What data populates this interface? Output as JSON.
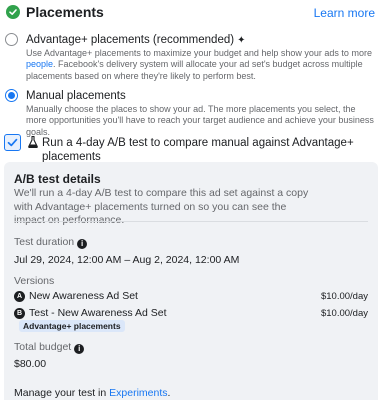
{
  "header": {
    "title": "Placements",
    "learn_more": "Learn more"
  },
  "advantage_option": {
    "title": "Advantage+ placements (recommended)",
    "description_before_link": "Use Advantage+ placements to maximize your budget and help show your ads to more ",
    "description_link": "people",
    "description_after_link": ". Facebook's delivery system will allocate your ad set's budget across multiple placements based on where they're likely to perform best.",
    "selected": false
  },
  "manual_option": {
    "title": "Manual placements",
    "description": "Manually choose the places to show your ad. The more placements you select, the more opportunities you'll have to reach your target audience and achieve your business goals.",
    "selected": true
  },
  "ab_test": {
    "label": "Run a 4-day A/B test to compare manual against Advantage+ placements",
    "checked": true
  },
  "details": {
    "title": "A/B test details",
    "description": "We'll run a 4-day A/B test to compare this ad set against a copy with Advantage+ placements turned on so you can see the impact on performance.",
    "duration_label": "Test duration",
    "duration_value": "Jul 29, 2024, 12:00 AM – Aug 2, 2024, 12:00 AM",
    "versions_label": "Versions",
    "versions": [
      {
        "badge": "A",
        "name": "New Awareness Ad Set",
        "price": "$10.00/day"
      },
      {
        "badge": "B",
        "name": "Test - New Awareness Ad Set",
        "price": "$10.00/day",
        "tag": "Advantage+ placements"
      }
    ],
    "budget_label": "Total budget",
    "budget_value": "$80.00",
    "manage_text": "Manage your test in ",
    "manage_link": "Experiments",
    "manage_end": "."
  },
  "colors": {
    "accent": "#1877f2",
    "success": "#31a24c",
    "panel_bg": "#f0f2f5",
    "muted_text": "#65676b"
  }
}
